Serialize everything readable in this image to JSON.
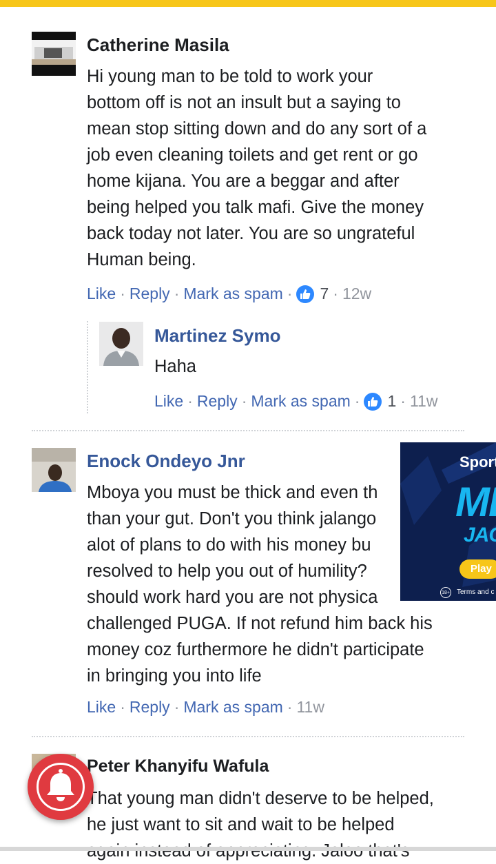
{
  "comments": [
    {
      "author": "Catherine Masila",
      "lines": [
        "Hi young man to be told to work your",
        "bottom off is not an insult but a saying to",
        "mean stop sitting down and do any sort of a",
        "job even cleaning toilets and get rent or go",
        "home kijana. You are a beggar and after",
        "being helped you talk mafi. Give the money",
        "back today not later. You are so ungrateful",
        "Human being."
      ],
      "like": "Like",
      "reply": "Reply",
      "spam": "Mark as spam",
      "reactions": "7",
      "time": "12w"
    },
    {
      "author": "Martinez Symo",
      "lines": [
        "Haha"
      ],
      "like": "Like",
      "reply": "Reply",
      "spam": "Mark as spam",
      "reactions": "1",
      "time": "11w"
    },
    {
      "author": "Enock Ondeyo Jnr",
      "lines": [
        "Mboya you must be thick and even th",
        "than your gut. Don't you think jalango",
        "alot of plans to do with his money bu",
        "resolved to help you out of humility?",
        "should work hard you are not physica",
        "challenged PUGA. If not refund him back his",
        "money coz furthermore he didn't participate",
        "in bringing you into life"
      ],
      "like": "Like",
      "reply": "Reply",
      "spam": "Mark as spam",
      "time": "11w"
    },
    {
      "author": "Peter Khanyifu Wafula",
      "lines": [
        "That young man didn't deserve to be helped,",
        "he just want to sit and wait to be helped",
        "again instead of appreciating. Jaloo that's"
      ]
    }
  ],
  "ad": {
    "brand": "Sport",
    "big1": "ME",
    "big2": "JACK",
    "button": "Play",
    "age": "18+",
    "terms": "Terms and c"
  },
  "icons": {
    "reaction": "thumbs-up-icon",
    "notification": "bell-icon"
  },
  "colors": {
    "top_bar": "#f7c619",
    "author_name": "#365899",
    "link": "#4267b2",
    "reaction_badge": "#2d88ff",
    "bell_button": "#e03a40",
    "ad_background": "#0d1f4e"
  }
}
